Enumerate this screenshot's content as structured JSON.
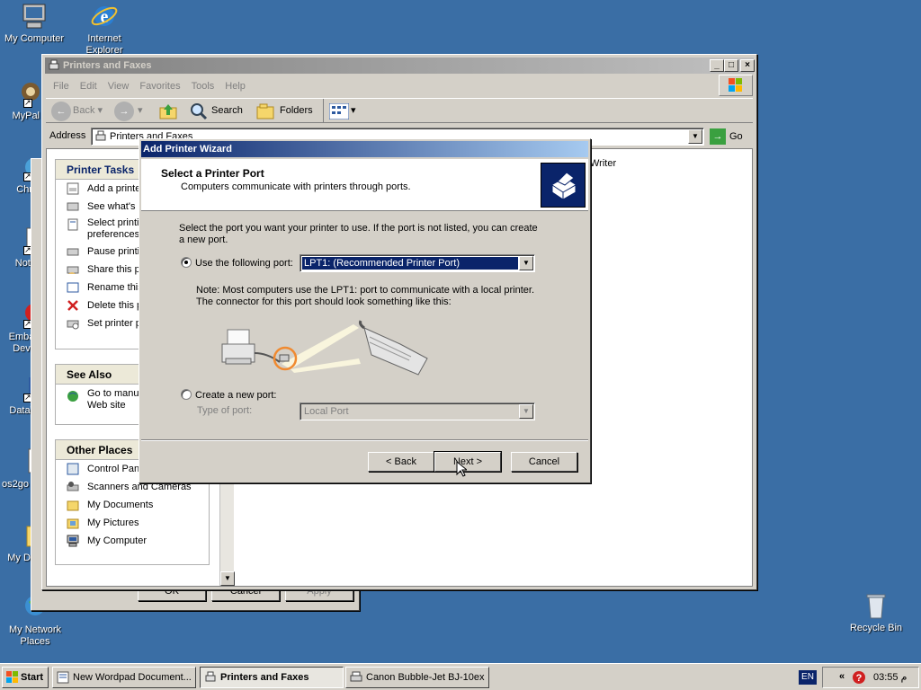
{
  "desktop": {
    "icons": [
      {
        "label": "My Computer"
      },
      {
        "label": "Internet Explorer"
      },
      {
        "label": "MyPal"
      },
      {
        "label": "Chr"
      },
      {
        "label": "Note"
      },
      {
        "label": "Emba Dev"
      },
      {
        "label": "DataW"
      },
      {
        "label": "os2go"
      },
      {
        "label": "My Do"
      },
      {
        "label": "My Network Places"
      },
      {
        "label": "Recycle Bin"
      }
    ]
  },
  "explorer": {
    "title": "Printers and Faxes",
    "menu": [
      "File",
      "Edit",
      "View",
      "Favorites",
      "Tools",
      "Help"
    ],
    "toolbar": {
      "back": "Back",
      "search": "Search",
      "folders": "Folders"
    },
    "address_label": "Address",
    "address_value": "Printers and Faxes",
    "go_label": "Go",
    "printer_tasks": {
      "heading": "Printer Tasks",
      "items": [
        "Add a printe",
        "See what's p",
        "Select printi",
        "preferences",
        "Pause printi",
        "Share this p",
        "Rename this",
        "Delete this p",
        "Set printer p"
      ]
    },
    "see_also": {
      "heading": "See Also",
      "items": [
        "Go to manuf",
        "Web site"
      ]
    },
    "other_places": {
      "heading": "Other Places",
      "items": [
        "Control Pane",
        "Scanners and Cameras",
        "My Documents",
        "My Pictures",
        "My Computer"
      ]
    },
    "partial_item": "Writer"
  },
  "background_dialog": {
    "ok": "OK",
    "cancel": "Cancel",
    "apply": "Apply"
  },
  "wizard": {
    "title": "Add Printer Wizard",
    "header_title": "Select a Printer Port",
    "header_subtitle": "Computers communicate with printers through ports.",
    "intro": "Select the port you want your printer to use.  If the port is not listed, you can create a new port.",
    "use_port_label": "Use the following port:",
    "port_value": "LPT1: (Recommended Printer Port)",
    "note": "Note: Most computers use the LPT1: port to communicate with a local printer. The connector for this port should look something like this:",
    "create_port_label": "Create a new port:",
    "type_of_port_label": "Type of port:",
    "type_of_port_value": "Local Port",
    "back_button": "< Back",
    "next_button": "Next >",
    "cancel_button": "Cancel"
  },
  "taskbar": {
    "start": "Start",
    "tasks": [
      "New Wordpad Document...",
      "Printers and Faxes",
      "Canon Bubble-Jet BJ-10ex"
    ],
    "lang": "EN",
    "clock": "03:55 م"
  }
}
